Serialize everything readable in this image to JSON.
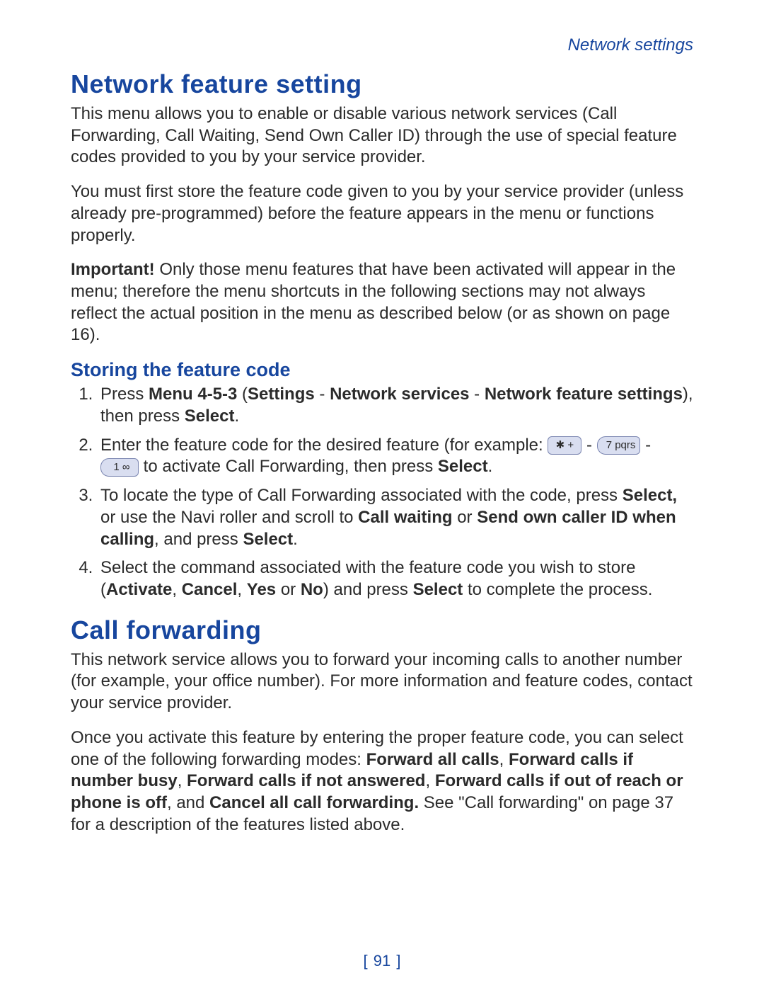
{
  "running_head": "Network settings",
  "sections": {
    "nfs": {
      "title": "Network feature setting",
      "p1": "This menu allows you to enable or disable various network services (Call Forwarding, Call Waiting, Send Own Caller ID) through the use of special feature codes provided to you by your service provider.",
      "p2": "You must first store the feature code given to you by your service provider (unless already pre-programmed) before the feature appears in the menu or functions properly.",
      "p3_strong": "Important!",
      "p3_rest": "  Only those menu features that have been activated will appear in the menu; therefore the menu shortcuts in the following sections may not always reflect the actual position in the menu as described below (or as shown on page 16).",
      "sub1": "Storing the feature code",
      "step1_a": "Press ",
      "step1_b": "Menu 4-5-3",
      "step1_c": " (",
      "step1_d": "Settings",
      "step1_e": " - ",
      "step1_f": "Network services",
      "step1_g": " - ",
      "step1_h": "Network feature settings",
      "step1_i": "), then press ",
      "step1_j": "Select",
      "step1_k": ".",
      "step2_a": "Enter the feature code for the desired feature (for example: ",
      "step2_b": "  - ",
      "step2_c": "  - ",
      "step2_d": " to activate Call Forwarding, then press ",
      "step2_e": "Select",
      "step2_f": ".",
      "step3_a": "To locate the type of Call Forwarding associated with the code, press ",
      "step3_b": "Select,",
      "step3_c": " or use the Navi roller and scroll to ",
      "step3_d": "Call waiting",
      "step3_e": " or ",
      "step3_f": "Send own caller ID when calling",
      "step3_g": ", and press ",
      "step3_h": "Select",
      "step3_i": ".",
      "step4_a": "Select the command associated with the feature code you wish to store (",
      "step4_b": "Activate",
      "step4_c": ", ",
      "step4_d": "Cancel",
      "step4_e": ", ",
      "step4_f": "Yes",
      "step4_g": " or ",
      "step4_h": "No",
      "step4_i": ") and press ",
      "step4_j": "Select",
      "step4_k": " to complete the process."
    },
    "cf": {
      "title": "Call forwarding",
      "p1": "This network service allows you to forward your incoming calls to another number (for example, your office number). For more information and feature codes, contact your service provider.",
      "p2_a": "Once you activate this feature by entering the proper feature code, you can select one of the following forwarding modes: ",
      "p2_b": "Forward all calls",
      "p2_c": ", ",
      "p2_d": "Forward calls if number busy",
      "p2_e": ", ",
      "p2_f": "Forward calls if not answered",
      "p2_g": ", ",
      "p2_h": "Forward calls if out of reach or phone is off",
      "p2_i": ", and ",
      "p2_j": "Cancel all call forwarding.",
      "p2_k": " See \"Call forwarding\" on page 37 for a description of the features listed above."
    }
  },
  "keys": {
    "star": "✱ +",
    "seven": "7 pqrs",
    "one": "1 ∞"
  },
  "page_number": "91"
}
